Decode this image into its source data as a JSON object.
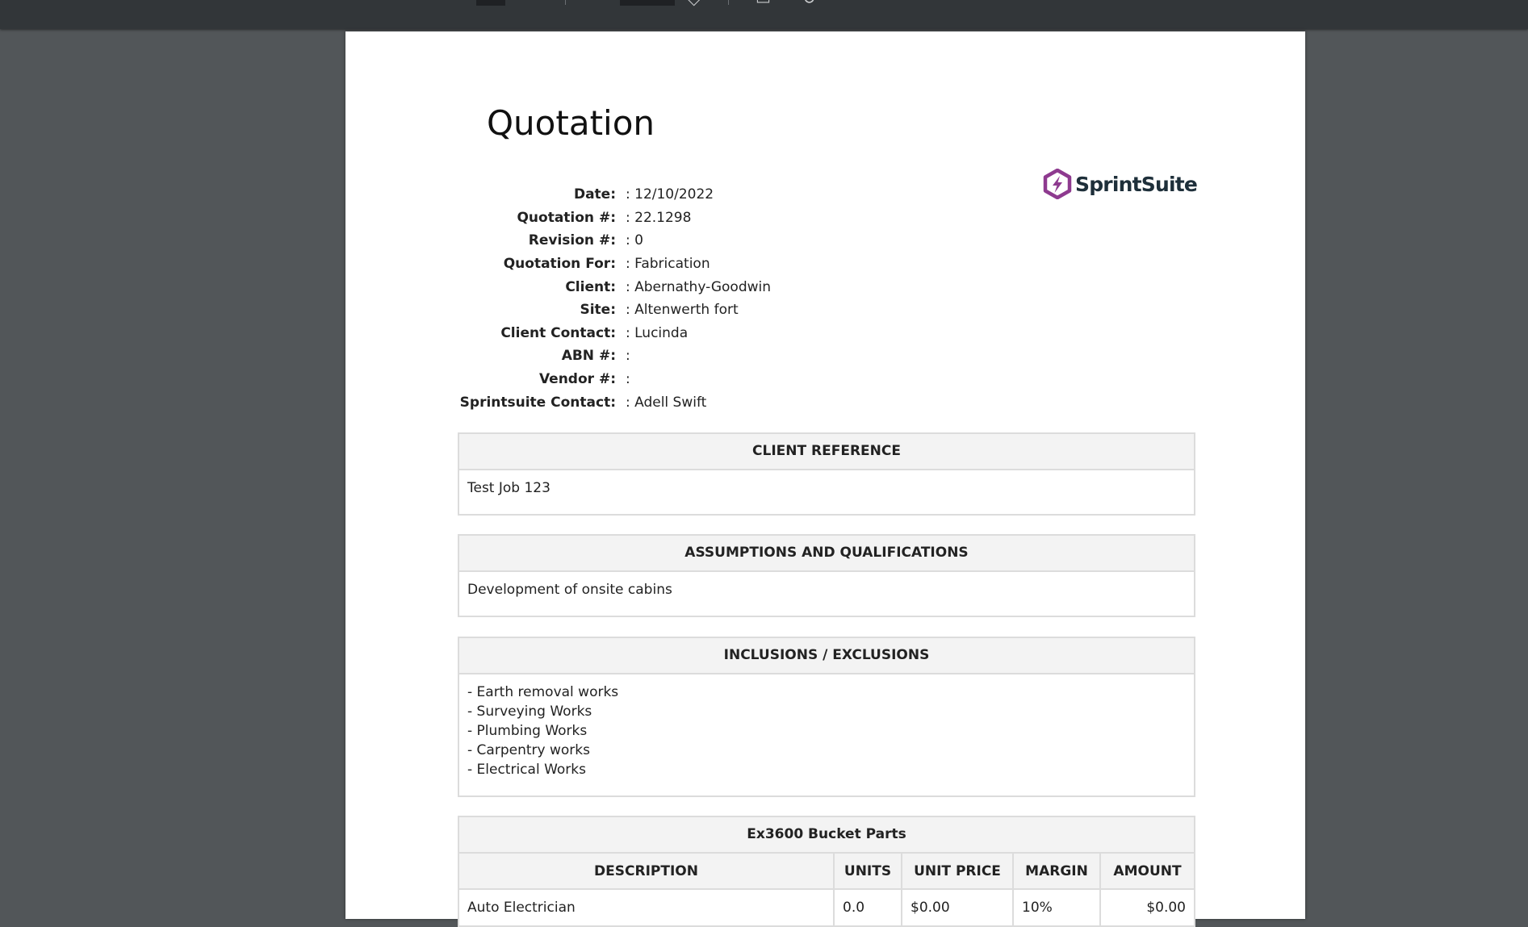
{
  "document": {
    "title": "Quotation",
    "logo_text": "SprintSuite",
    "meta": [
      {
        "label": "Date:",
        "value": ": 12/10/2022"
      },
      {
        "label": "Quotation #:",
        "value": ": 22.1298"
      },
      {
        "label": "Revision #:",
        "value": ": 0"
      },
      {
        "label": "Quotation For:",
        "value": ": Fabrication"
      },
      {
        "label": "Client:",
        "value": ": Abernathy-Goodwin"
      },
      {
        "label": "Site:",
        "value": ": Altenwerth fort"
      },
      {
        "label": "Client Contact:",
        "value": ": Lucinda"
      },
      {
        "label": "ABN #:",
        "value": ":"
      },
      {
        "label": "Vendor #:",
        "value": ":"
      },
      {
        "label": "Sprintsuite Contact:",
        "value": ": Adell Swift"
      }
    ],
    "client_reference": {
      "heading": "CLIENT REFERENCE",
      "body": "Test Job 123"
    },
    "assumptions": {
      "heading": "ASSUMPTIONS AND QUALIFICATIONS",
      "body": "Development of onsite cabins"
    },
    "inclusions": {
      "heading": "INCLUSIONS / EXCLUSIONS",
      "items": [
        "- Earth removal works",
        "- Surveying Works",
        "- Plumbing Works",
        "- Carpentry works",
        "- Electrical Works"
      ]
    },
    "parts": {
      "heading": "Ex3600 Bucket Parts",
      "columns": [
        "DESCRIPTION",
        "UNITS",
        "UNIT PRICE",
        "MARGIN",
        "AMOUNT"
      ],
      "rows": [
        {
          "description": "Auto Electrician",
          "units": "0.0",
          "unit_price": "$0.00",
          "margin": "10%",
          "amount": "$0.00"
        }
      ]
    }
  },
  "colors": {
    "viewer_background": "#525659",
    "toolbar_background": "#323639",
    "logo_accent": "#8e3a8f",
    "logo_text": "#1e2f3a"
  }
}
